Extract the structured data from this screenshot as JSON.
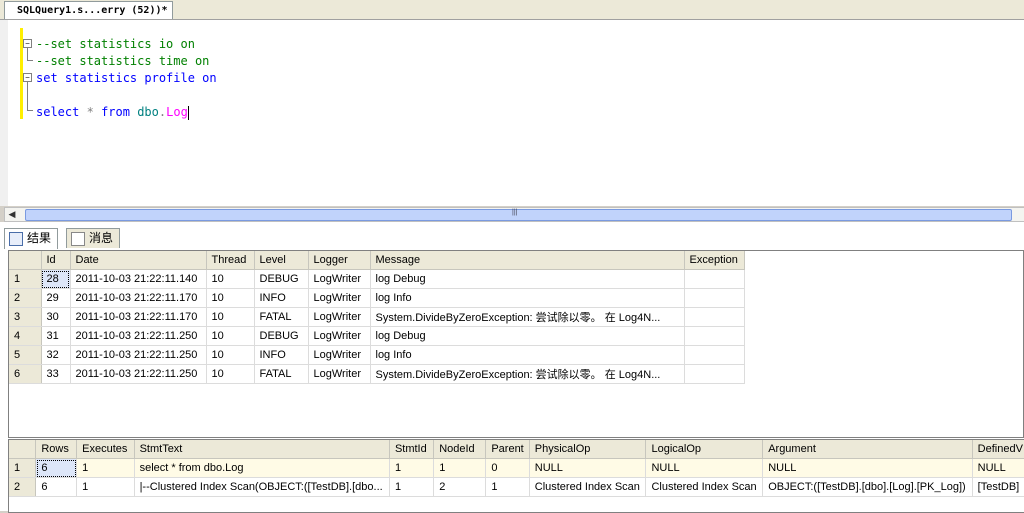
{
  "tab": {
    "title": "SQLQuery1.s...erry (52))*"
  },
  "editor": {
    "lines": [
      {
        "parts": [
          {
            "cls": "comment",
            "t": "--set statistics io on"
          }
        ]
      },
      {
        "parts": [
          {
            "cls": "comment",
            "t": "--set statistics time on"
          }
        ]
      },
      {
        "parts": [
          {
            "cls": "kw",
            "t": "set statistics profile on"
          }
        ]
      },
      {
        "parts": [
          {
            "cls": "",
            "t": ""
          }
        ]
      },
      {
        "parts": [
          {
            "cls": "kw",
            "t": "select"
          },
          {
            "cls": "",
            "t": " "
          },
          {
            "cls": "op",
            "t": "*"
          },
          {
            "cls": "",
            "t": " "
          },
          {
            "cls": "kw",
            "t": "from"
          },
          {
            "cls": "",
            "t": " "
          },
          {
            "cls": "obj",
            "t": "dbo"
          },
          {
            "cls": "op",
            "t": "."
          },
          {
            "cls": "fn",
            "t": "Log"
          }
        ]
      }
    ]
  },
  "results_tabs": [
    {
      "label": "结果",
      "active": true
    },
    {
      "label": "消息",
      "active": false
    }
  ],
  "grid1": {
    "columns": [
      "Id",
      "Date",
      "Thread",
      "Level",
      "Logger",
      "Message",
      "Exception"
    ],
    "rows": [
      [
        "1",
        "28",
        "2011-10-03 21:22:11.140",
        "10",
        "DEBUG",
        "LogWriter",
        "log Debug",
        ""
      ],
      [
        "2",
        "29",
        "2011-10-03 21:22:11.170",
        "10",
        "INFO",
        "LogWriter",
        "log Info",
        ""
      ],
      [
        "3",
        "30",
        "2011-10-03 21:22:11.170",
        "10",
        "FATAL",
        "LogWriter",
        "System.DivideByZeroException: 尝试除以零。    在 Log4N...",
        ""
      ],
      [
        "4",
        "31",
        "2011-10-03 21:22:11.250",
        "10",
        "DEBUG",
        "LogWriter",
        "log Debug",
        ""
      ],
      [
        "5",
        "32",
        "2011-10-03 21:22:11.250",
        "10",
        "INFO",
        "LogWriter",
        "log Info",
        ""
      ],
      [
        "6",
        "33",
        "2011-10-03 21:22:11.250",
        "10",
        "FATAL",
        "LogWriter",
        "System.DivideByZeroException: 尝试除以零。    在 Log4N...",
        ""
      ]
    ]
  },
  "grid2": {
    "columns": [
      "Rows",
      "Executes",
      "StmtText",
      "StmtId",
      "NodeId",
      "Parent",
      "PhysicalOp",
      "LogicalOp",
      "Argument",
      "DefinedV"
    ],
    "rows": [
      [
        "1",
        "6",
        "1",
        "select * from dbo.Log",
        "1",
        "1",
        "0",
        "NULL",
        "NULL",
        "NULL",
        "NULL"
      ],
      [
        "2",
        "6",
        "1",
        "  |--Clustered Index Scan(OBJECT:([TestDB].[dbo...",
        "1",
        "2",
        "1",
        "Clustered Index Scan",
        "Clustered Index Scan",
        "OBJECT:([TestDB].[dbo].[Log].[PK_Log])",
        "[TestDB]"
      ]
    ]
  }
}
